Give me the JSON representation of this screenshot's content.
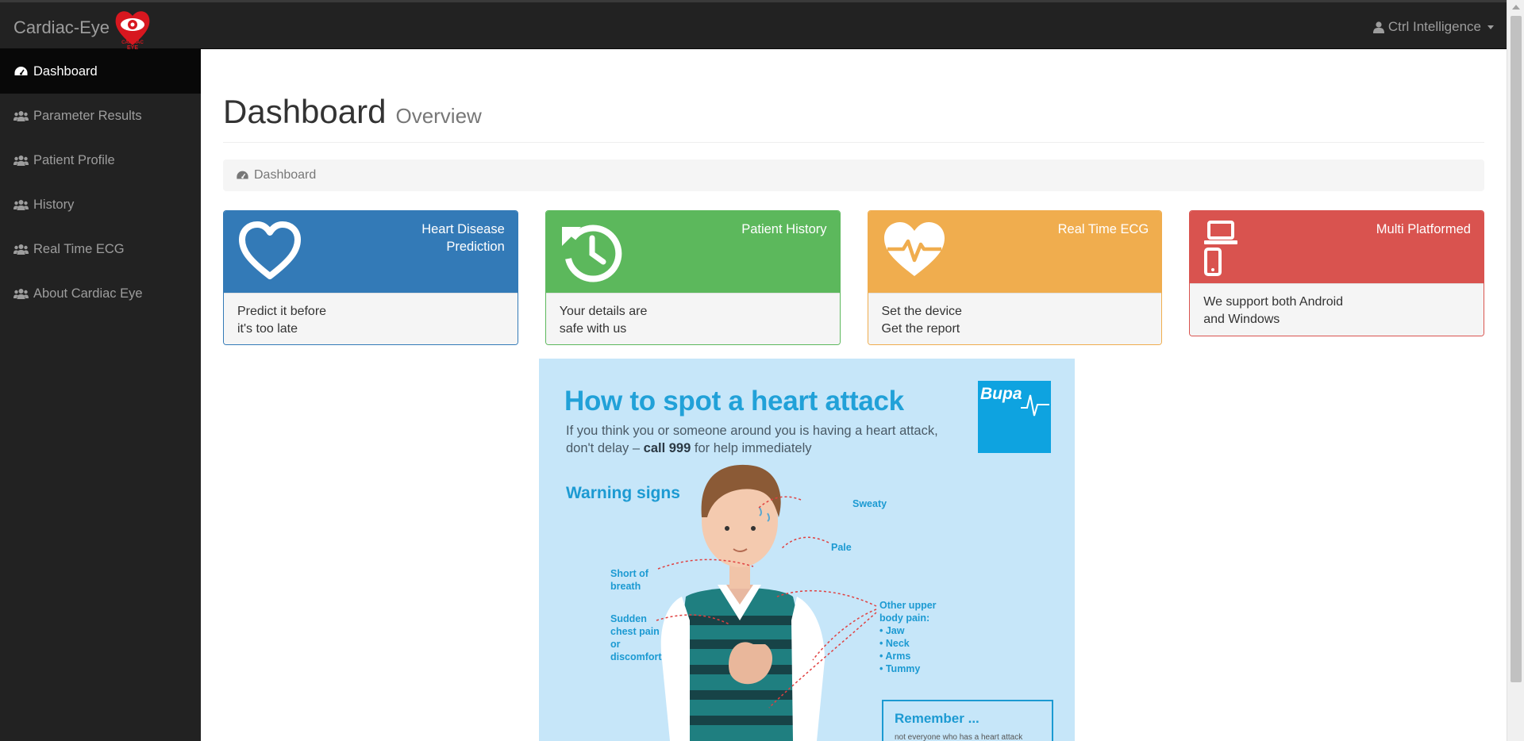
{
  "app": {
    "brand": "Cardiac-Eye",
    "logo_text": "CARDIAC EYE",
    "user": "Ctrl Intelligence"
  },
  "sidebar": {
    "items": [
      {
        "label": "Dashboard",
        "icon": "dashboard-icon",
        "active": true
      },
      {
        "label": "Parameter Results",
        "icon": "users-icon"
      },
      {
        "label": "Patient Profile",
        "icon": "users-icon"
      },
      {
        "label": "History",
        "icon": "users-icon"
      },
      {
        "label": "Real Time ECG",
        "icon": "users-icon"
      },
      {
        "label": "About Cardiac Eye",
        "icon": "users-icon"
      }
    ]
  },
  "header": {
    "title": "Dashboard",
    "subtitle": "Overview"
  },
  "breadcrumb": {
    "label": "Dashboard"
  },
  "panels": [
    {
      "title": "Heart Disease Prediction",
      "icon": "heart-outline-icon",
      "line1": "Predict it before",
      "line2": "it's too late",
      "color": "#337ab7"
    },
    {
      "title": "Patient History",
      "icon": "history-icon",
      "line1": "Your details are",
      "line2": "safe with us",
      "color": "#5cb85c"
    },
    {
      "title": "Real Time ECG",
      "icon": "heartbeat-icon",
      "line1": "Set the device",
      "line2": "Get the report",
      "color": "#f0ad4e"
    },
    {
      "title": "Multi Platformed",
      "icon": "devices-icon",
      "line1": "We support both Android",
      "line2": "and Windows",
      "color": "#d9534f"
    }
  ],
  "infographic": {
    "title": "How to spot a heart attack",
    "sub_before": "If you think you or someone around you is having a heart attack, don't delay – ",
    "sub_bold": "call 999",
    "sub_after": " for help immediately",
    "logo": "Bupa",
    "warning": "Warning signs",
    "labels": {
      "sweaty": "Sweaty",
      "pale": "Pale",
      "short_breath": "Short of breath",
      "chest": "Sudden chest pain or discomfort",
      "upper_body": "Other upper body pain:",
      "jaw": "• Jaw",
      "neck": "• Neck",
      "arms": "• Arms",
      "tummy": "• Tummy"
    },
    "remember": "Remember ...",
    "remember_text": "not everyone who has a heart attack"
  }
}
